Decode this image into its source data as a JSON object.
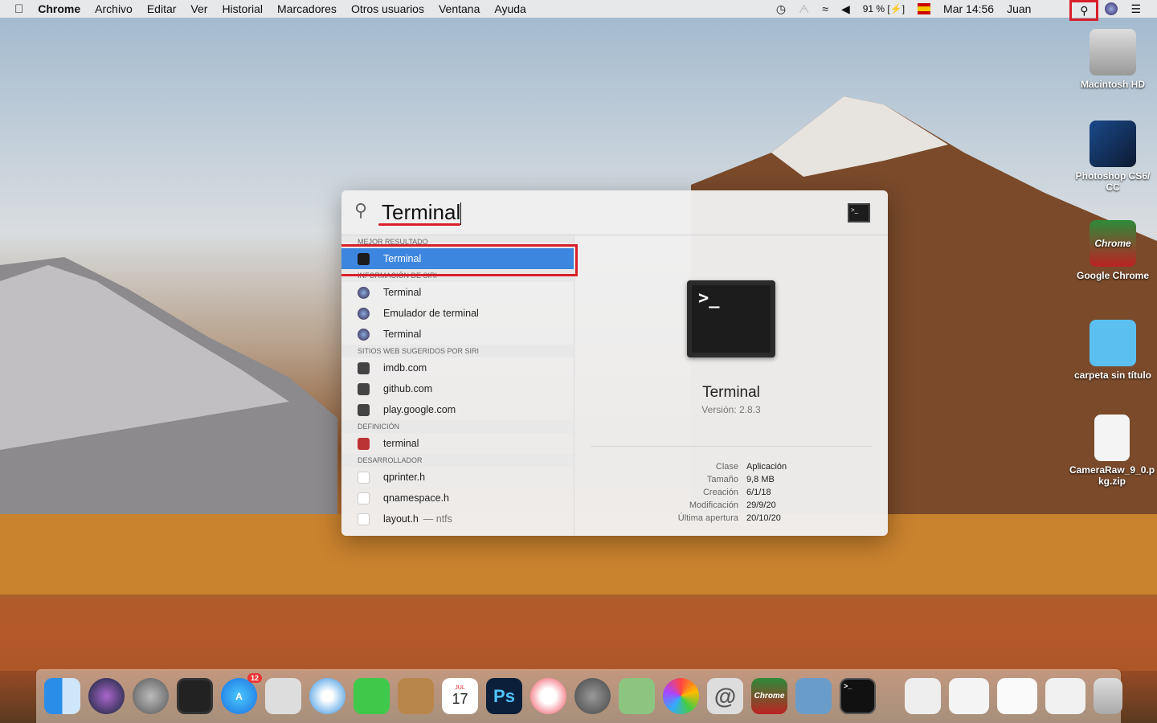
{
  "menubar": {
    "app": "Chrome",
    "items": [
      "Archivo",
      "Editar",
      "Ver",
      "Historial",
      "Marcadores",
      "Otros usuarios",
      "Ventana",
      "Ayuda"
    ],
    "battery": "91 %",
    "datetime": "Mar 14:56",
    "user": "Juan"
  },
  "desktop": [
    "Macintosh HD",
    "Photoshop CS6/ CC",
    "Google Chrome",
    "carpeta sin título",
    "CameraRaw_9_0.pkg.zip"
  ],
  "spotlight": {
    "query": "Terminal",
    "sections": [
      {
        "title": "MEJOR RESULTADO",
        "items": [
          {
            "label": "Terminal",
            "icon": "terminal-icon",
            "selected": true
          }
        ]
      },
      {
        "title": "INFORMACIÓN DE SIRI",
        "items": [
          {
            "label": "Terminal",
            "icon": "siri-icon"
          },
          {
            "label": "Emulador de terminal",
            "icon": "siri-icon"
          },
          {
            "label": "Terminal",
            "icon": "siri-icon"
          }
        ]
      },
      {
        "title": "SITIOS WEB SUGERIDOS POR SIRI",
        "items": [
          {
            "label": "imdb.com",
            "icon": "web-icon"
          },
          {
            "label": "github.com",
            "icon": "web-icon"
          },
          {
            "label": "play.google.com",
            "icon": "web-icon"
          }
        ]
      },
      {
        "title": "DEFINICIÓN",
        "items": [
          {
            "label": "terminal",
            "icon": "dictionary-icon"
          }
        ]
      },
      {
        "title": "DESARROLLADOR",
        "items": [
          {
            "label": "qprinter.h",
            "icon": "file-icon"
          },
          {
            "label": "qnamespace.h",
            "icon": "file-icon"
          },
          {
            "label": "layout.h",
            "sub": "— ntfs",
            "icon": "file-icon"
          }
        ]
      }
    ],
    "preview": {
      "name": "Terminal",
      "version": "Versión: 2.8.3",
      "meta": [
        [
          "Clase",
          "Aplicación"
        ],
        [
          "Tamaño",
          "9,8 MB"
        ],
        [
          "Creación",
          "6/1/18"
        ],
        [
          "Modificación",
          "29/9/20"
        ],
        [
          "Última apertura",
          "20/10/20"
        ]
      ]
    }
  },
  "dock": {
    "appstore_badge": "12",
    "calendar_day": "17",
    "calendar_month": "JUL",
    "ps": "Ps",
    "chrome": "Chrome"
  },
  "colors": {
    "selection": "#3d86e0",
    "highlight": "#d9202a"
  }
}
